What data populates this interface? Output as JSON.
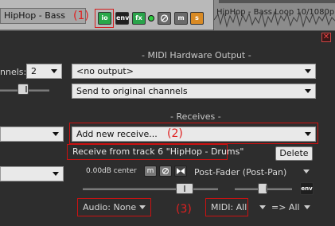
{
  "track": {
    "name": "HipHop - Bass",
    "annotation1": "(1)",
    "buttons": {
      "io": "io",
      "env": "env",
      "fx": "fx",
      "mute": "m",
      "solo": "s"
    },
    "waveform_text": "HipHop - Bass Loop 10/1080p..."
  },
  "dialog": {
    "channels_label": "nnels:",
    "channels_value": "2",
    "midi_hw_heading": "- MIDI Hardware Output -",
    "midi_output_value": "<no output>",
    "midi_send_value": "Send to original channels",
    "receives_heading": "- Receives -",
    "add_receive_value": "Add new receive...",
    "annotation2": "(2)",
    "receive_item": "Receive from track 6 \"HipHop - Drums\"",
    "delete_label": "Delete",
    "volume_readout": "0.00dB center",
    "post_fader_label": "Post-Fader (Post-Pan)",
    "env_label": "env",
    "audio_label": "Audio: None",
    "annotation3": "(3)",
    "midi_label": "MIDI: All",
    "midi_dest_label": "=> All"
  },
  "colors": {
    "io_bg": "#2aa84a",
    "env_bg": "#1f1f1f",
    "fx_bg": "#29a34a",
    "mute_bg": "#6a6a6a",
    "solo_bg": "#d98a24",
    "annotation": "#e02020"
  },
  "icons": [
    "dropdown-arrow-icon",
    "close-icon",
    "mute-icon",
    "phase-icon",
    "mono-icon"
  ]
}
